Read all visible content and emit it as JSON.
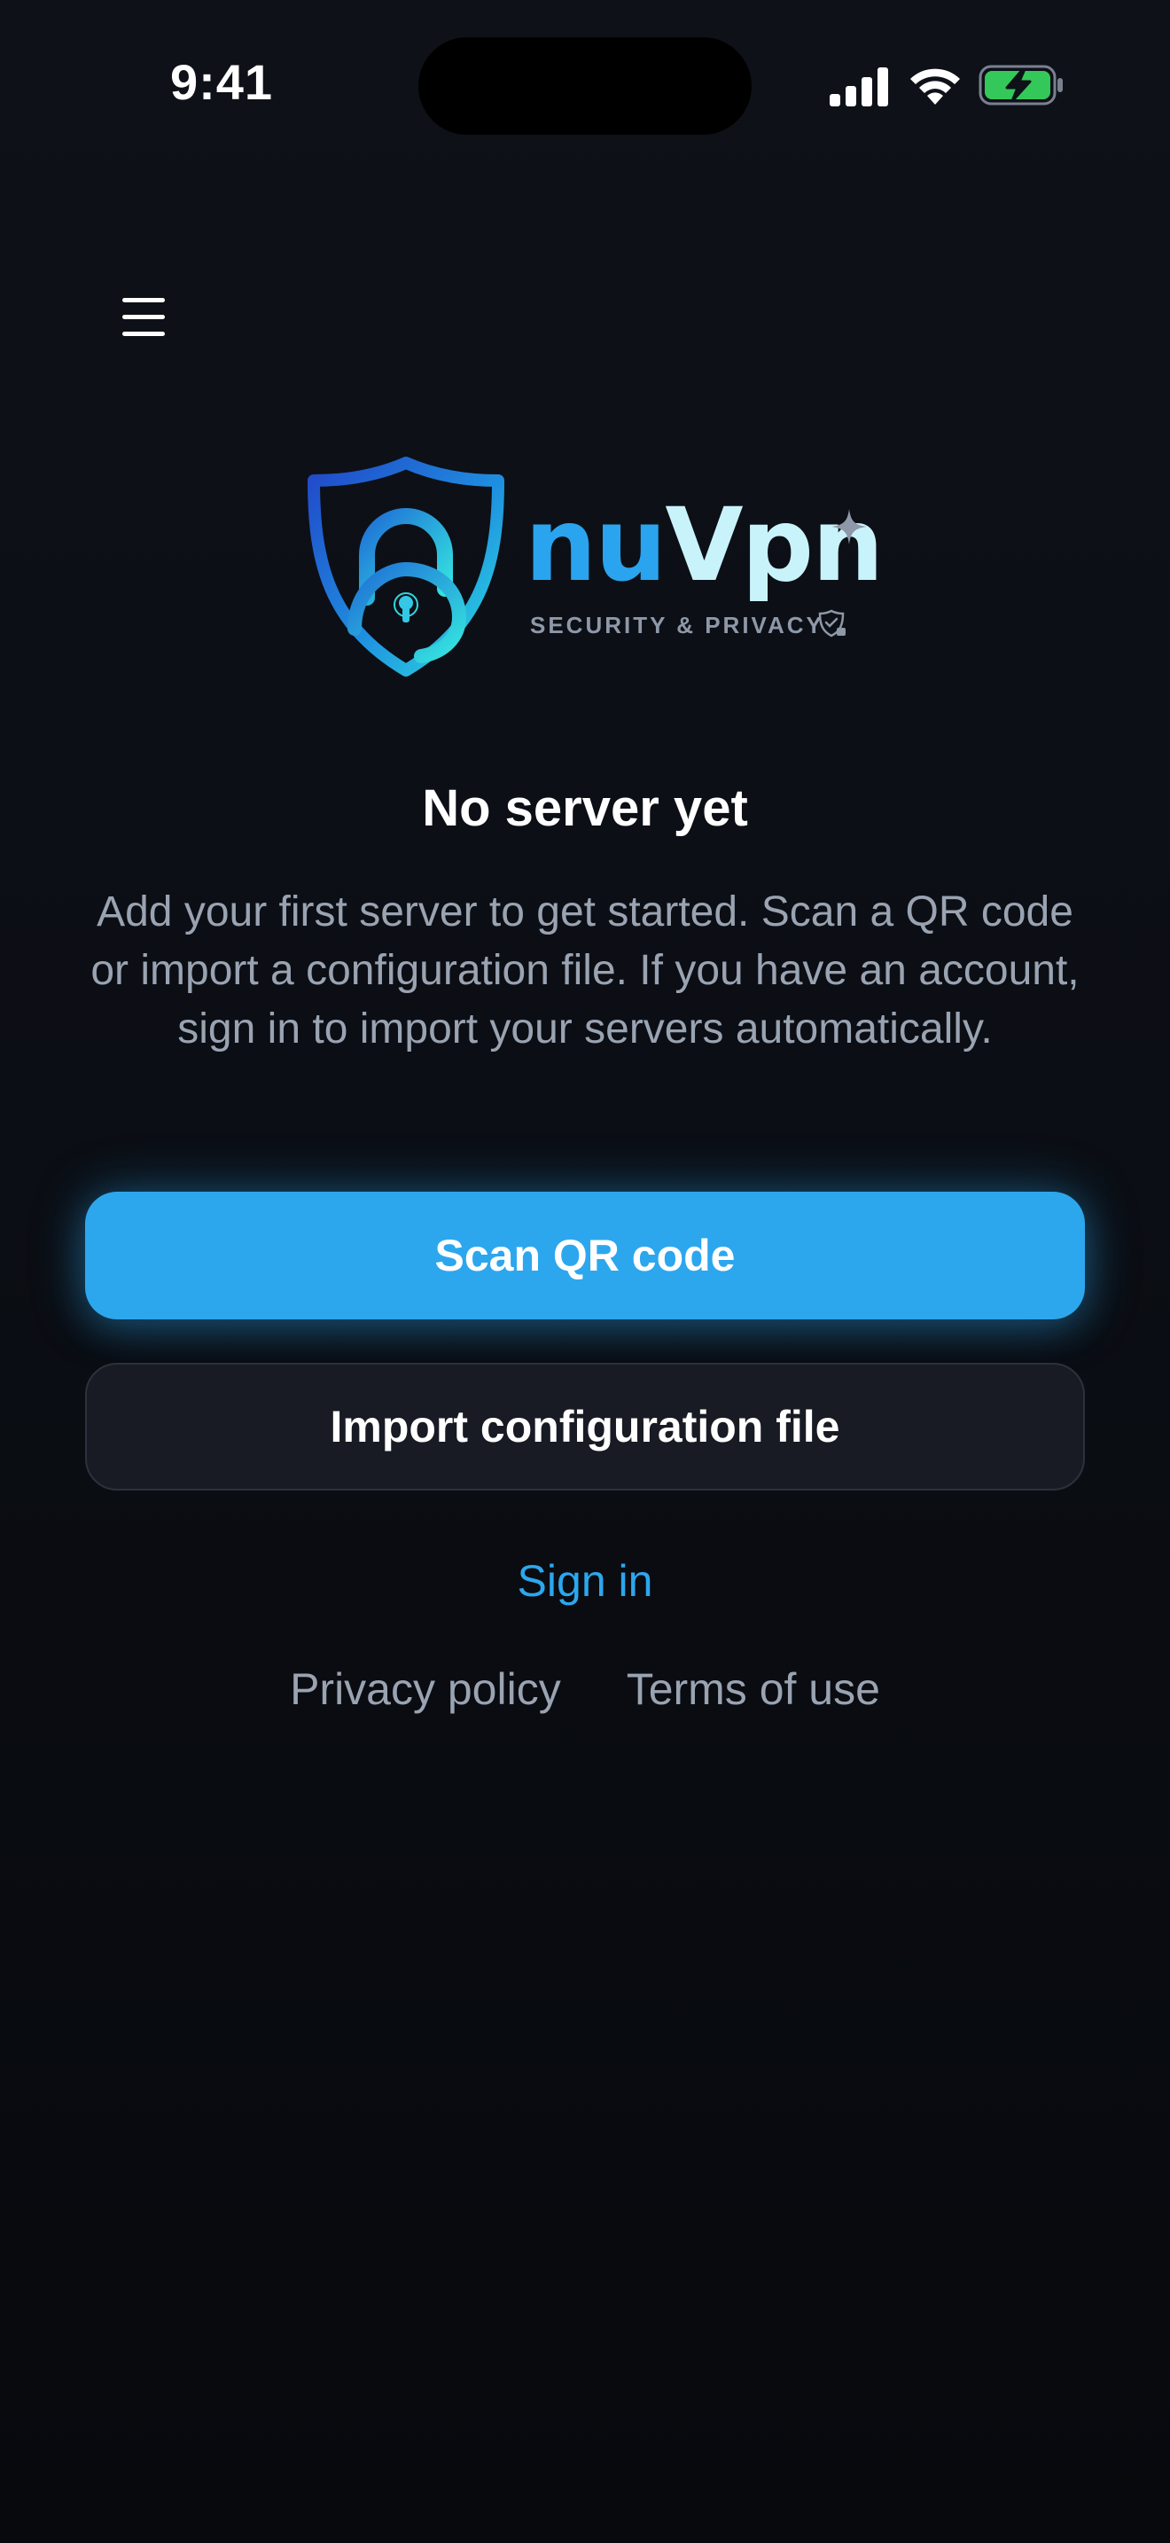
{
  "status_bar": {
    "time": "9:41",
    "battery_color": "#34c759",
    "icons": [
      "signal-icon",
      "wifi-icon",
      "battery-charging-icon"
    ]
  },
  "header": {
    "menu_icon": "hamburger-menu-icon"
  },
  "logo": {
    "brand_part1": "nu",
    "brand_part2": "Vpn",
    "tagline": "SECURITY & PRIVACY",
    "brand_color_primary": "#2aa4ee",
    "brand_color_secondary": "#c9f3fb"
  },
  "empty_state": {
    "title": "No server yet",
    "description": "Add your first server to get started. Scan a QR code or import a configuration file. If you have an account, sign in to import your servers automatically."
  },
  "actions": {
    "scan_qr_label": "Scan QR code",
    "import_config_label": "Import configuration file",
    "sign_in_label": "Sign in",
    "accent_color": "#2ca7ee"
  },
  "footer": {
    "privacy_label": "Privacy policy",
    "terms_label": "Terms of use"
  }
}
